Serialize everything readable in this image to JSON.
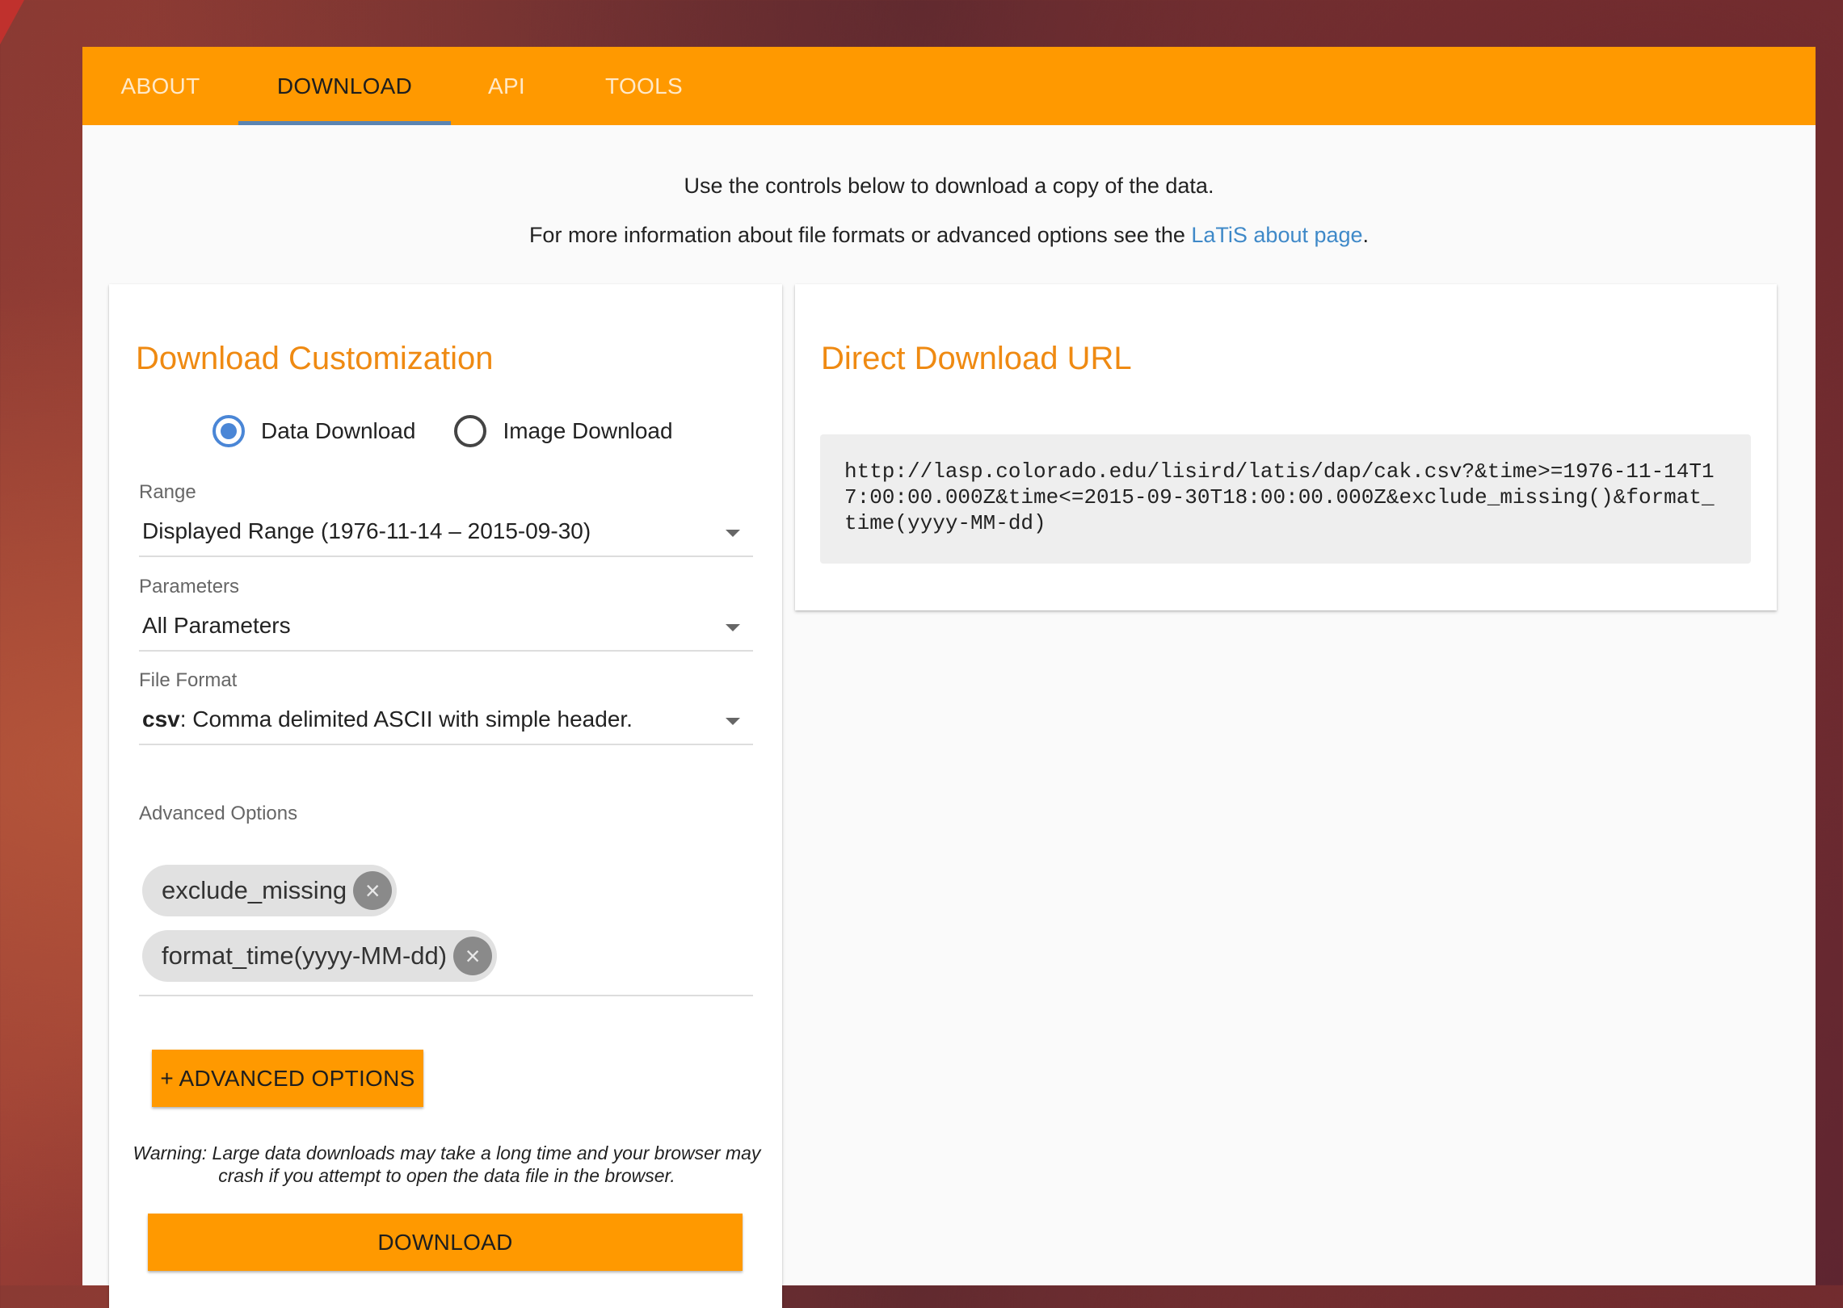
{
  "tabs": [
    {
      "label": "ABOUT",
      "active": false
    },
    {
      "label": "DOWNLOAD",
      "active": true
    },
    {
      "label": "API",
      "active": false
    },
    {
      "label": "TOOLS",
      "active": false
    }
  ],
  "intro": {
    "line1": "Use the controls below to download a copy of the data.",
    "line2_prefix": "For more information about file formats or advanced options see the ",
    "line2_link": "LaTiS about page",
    "line2_suffix": "."
  },
  "customization": {
    "title": "Download Customization",
    "radio_data": "Data Download",
    "radio_image": "Image Download",
    "range_label": "Range",
    "range_value": "Displayed Range (1976-11-14 – 2015-09-30)",
    "parameters_label": "Parameters",
    "parameters_value": "All Parameters",
    "format_label": "File Format",
    "format_code": "csv",
    "format_desc": ": Comma delimited ASCII with simple header.",
    "advanced_label": "Advanced Options",
    "chips": [
      "exclude_missing",
      "format_time(yyyy-MM-dd)"
    ],
    "advanced_button": "+ ADVANCED OPTIONS",
    "warning": "Warning: Large data downloads may take a long time and your browser may crash if you attempt to open the data file in the browser.",
    "download_button": "DOWNLOAD"
  },
  "direct": {
    "title": "Direct Download URL",
    "url": "http://lasp.colorado.edu/lisird/latis/dap/cak.csv?&time>=1976-11-14T17:00:00.000Z&time<=2015-09-30T18:00:00.000Z&exclude_missing()&format_time(yyyy-MM-dd)"
  },
  "colors": {
    "accent": "#ff9900",
    "title": "#ef8a12",
    "link": "#3f89c8",
    "radio": "#4a86d6",
    "tab_indicator": "#5b84b1"
  }
}
